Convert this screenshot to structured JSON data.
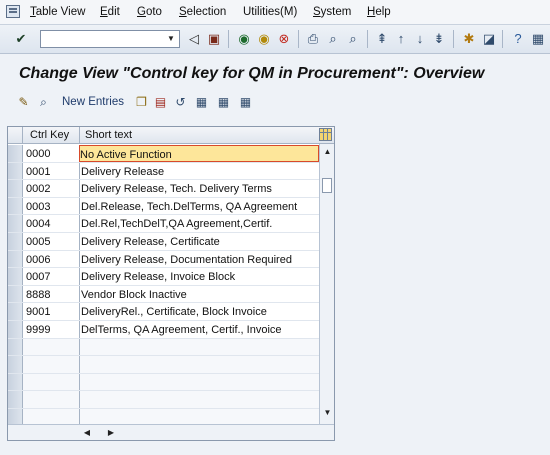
{
  "menu": {
    "items": [
      {
        "underline": "T",
        "rest": "able View"
      },
      {
        "underline": "E",
        "rest": "dit"
      },
      {
        "underline": "G",
        "rest": "oto"
      },
      {
        "underline": "S",
        "rest": "election"
      },
      {
        "underline": "",
        "rest": "Utilities(M)"
      },
      {
        "underline": "S",
        "rest": "ystem"
      },
      {
        "underline": "H",
        "rest": "elp"
      }
    ]
  },
  "command_field": {
    "value": ""
  },
  "title": "Change View \"Control key for QM in Procurement\": Overview",
  "app_toolbar": {
    "new_entries_label": "New Entries"
  },
  "table": {
    "columns": [
      "Ctrl Key",
      "Short text"
    ],
    "rows": [
      {
        "key": "0000",
        "text": "No Active Function"
      },
      {
        "key": "0001",
        "text": "Delivery Release"
      },
      {
        "key": "0002",
        "text": "Delivery Release, Tech. Delivery Terms"
      },
      {
        "key": "0003",
        "text": "Del.Release, Tech.DelTerms, QA Agreement"
      },
      {
        "key": "0004",
        "text": "Del.Rel,TechDelT,QA Agreement,Certif."
      },
      {
        "key": "0005",
        "text": "Delivery Release, Certificate"
      },
      {
        "key": "0006",
        "text": "Delivery Release, Documentation Required"
      },
      {
        "key": "0007",
        "text": "Delivery Release, Invoice Block"
      },
      {
        "key": "8888",
        "text": "Vendor Block Inactive"
      },
      {
        "key": "9001",
        "text": "DeliveryRel., Certificate, Block Invoice"
      },
      {
        "key": "9999",
        "text": "DelTerms, QA Agreement, Certif., Invoice"
      }
    ],
    "empty_rows": 5
  }
}
